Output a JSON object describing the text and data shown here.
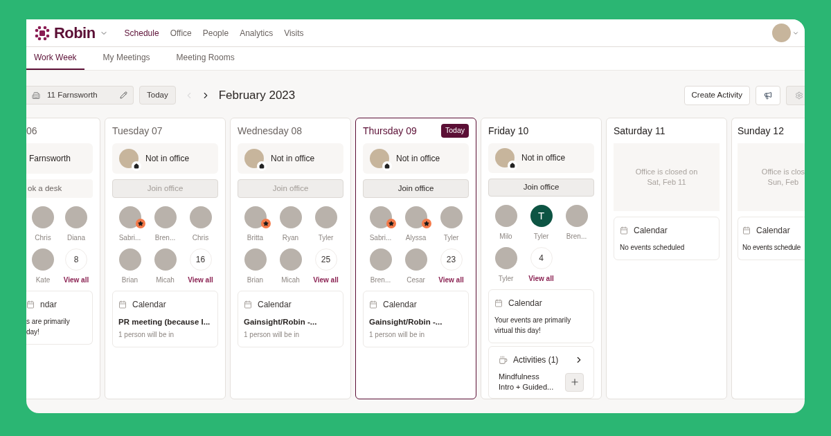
{
  "brand": {
    "name": "Robin"
  },
  "nav": [
    {
      "label": "Schedule",
      "selected": true
    },
    {
      "label": "Office",
      "selected": false
    },
    {
      "label": "People",
      "selected": false
    },
    {
      "label": "Analytics",
      "selected": false
    },
    {
      "label": "Visits",
      "selected": false
    }
  ],
  "tabs": [
    {
      "label": "Work Week",
      "selected": true
    },
    {
      "label": "My Meetings",
      "selected": false
    },
    {
      "label": "Meeting Rooms",
      "selected": false
    }
  ],
  "toolbar": {
    "location": "11 Farnsworth",
    "today_button": "Today",
    "prev_disabled": true,
    "month": "February 2023",
    "create_button": "Create Activity"
  },
  "days": [
    {
      "kind": "office",
      "clipped_left": true,
      "clipped_right": false,
      "title": "06",
      "today": false,
      "past": true,
      "status": "Farnsworth",
      "status_avatar": false,
      "action": {
        "kind": "field",
        "label": "ok a desk"
      },
      "people": [
        {
          "name": "Chris",
          "kind": "photo",
          "starred": false
        },
        {
          "name": "Diana",
          "kind": "photo",
          "starred": false
        },
        {
          "name": "Kate",
          "kind": "photo",
          "starred": false
        }
      ],
      "count": "8",
      "view_all": "View all",
      "calendar": {
        "title": "ndar",
        "note": "s are primarily\nday!"
      }
    },
    {
      "kind": "office",
      "clipped_left": false,
      "clipped_right": false,
      "title": "Tuesday 07",
      "today": false,
      "past": true,
      "status": "Not in office",
      "status_avatar": true,
      "action": {
        "kind": "button",
        "label": "Join office",
        "disabled": true
      },
      "people": [
        {
          "name": "Sabri...",
          "kind": "photo",
          "starred": true
        },
        {
          "name": "Bren...",
          "kind": "photo",
          "starred": false
        },
        {
          "name": "Chris",
          "kind": "photo",
          "starred": false
        },
        {
          "name": "Brian",
          "kind": "photo",
          "starred": false
        },
        {
          "name": "Micah",
          "kind": "photo",
          "starred": false
        }
      ],
      "count": "16",
      "view_all": "View all",
      "calendar": {
        "title": "Calendar",
        "event": "PR meeting (because I...",
        "sub": "1 person will be in"
      }
    },
    {
      "kind": "office",
      "clipped_left": false,
      "clipped_right": false,
      "title": "Wednesday 08",
      "today": false,
      "past": true,
      "status": "Not in office",
      "status_avatar": true,
      "action": {
        "kind": "button",
        "label": "Join office",
        "disabled": true
      },
      "people": [
        {
          "name": "Britta",
          "kind": "photo",
          "starred": true
        },
        {
          "name": "Ryan",
          "kind": "photo",
          "starred": false
        },
        {
          "name": "Tyler",
          "kind": "photo",
          "starred": false
        },
        {
          "name": "Brian",
          "kind": "photo",
          "starred": false
        },
        {
          "name": "Micah",
          "kind": "photo",
          "starred": false
        }
      ],
      "count": "25",
      "view_all": "View all",
      "calendar": {
        "title": "Calendar",
        "event": "Gainsight/Robin -...",
        "sub": "1 person will be in"
      }
    },
    {
      "kind": "office",
      "clipped_left": false,
      "clipped_right": false,
      "title": "Thursday 09",
      "today": true,
      "today_badge": "Today",
      "past": false,
      "status": "Not in office",
      "status_avatar": true,
      "action": {
        "kind": "button",
        "label": "Join office",
        "disabled": false
      },
      "people": [
        {
          "name": "Sabri...",
          "kind": "photo",
          "starred": true
        },
        {
          "name": "Alyssa",
          "kind": "photo",
          "starred": true
        },
        {
          "name": "Tyler",
          "kind": "photo",
          "starred": false
        },
        {
          "name": "Bren...",
          "kind": "photo",
          "starred": false
        },
        {
          "name": "Cesar",
          "kind": "photo",
          "starred": false
        }
      ],
      "count": "23",
      "view_all": "View all",
      "calendar": {
        "title": "Calendar",
        "event": "Gainsight/Robin -...",
        "sub": "1 person will be in"
      }
    },
    {
      "kind": "office",
      "clipped_left": false,
      "clipped_right": false,
      "title": "Friday 10",
      "today": false,
      "past": false,
      "status": "Not in office",
      "status_avatar": true,
      "action": {
        "kind": "button",
        "label": "Join office",
        "disabled": false
      },
      "people": [
        {
          "name": "Milo",
          "kind": "photo",
          "starred": false
        },
        {
          "name": "Tyler",
          "kind": "initial",
          "initial": "T",
          "starred": false
        },
        {
          "name": "Bren...",
          "kind": "photo",
          "starred": false
        },
        {
          "name": "Tyler",
          "kind": "photo",
          "starred": false
        }
      ],
      "count": "4",
      "view_all": "View all",
      "calendar": {
        "title": "Calendar",
        "note": "Your events are primarily virtual this day!"
      },
      "activities": {
        "title": "Activities (1)",
        "item": "Mindfulness\nIntro + Guided..."
      }
    },
    {
      "kind": "closed",
      "clipped_left": false,
      "clipped_right": false,
      "title": "Saturday 11",
      "today": false,
      "past": false,
      "closed_text": "Office is closed on\nSat, Feb 11",
      "calendar": {
        "title": "Calendar",
        "note": "No events scheduled"
      }
    },
    {
      "kind": "closed",
      "clipped_left": false,
      "clipped_right": true,
      "title": "Sunday 12",
      "today": false,
      "past": false,
      "closed_text": "Office is clos\nSun, Feb",
      "calendar": {
        "title": "Calendar",
        "note": "No events schedule"
      }
    }
  ]
}
